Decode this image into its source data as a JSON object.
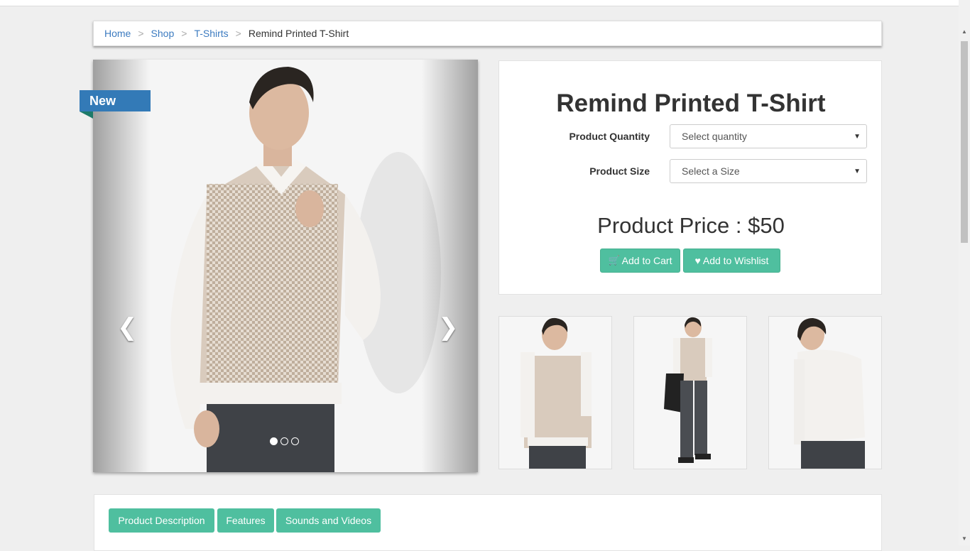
{
  "breadcrumb": {
    "items": [
      "Home",
      "Shop",
      "T-Shirts"
    ],
    "separator": ">",
    "current": "Remind Printed T-Shirt"
  },
  "carousel": {
    "badge": "New",
    "prev_icon": "chevron-left-icon",
    "next_icon": "chevron-right-icon",
    "slide_count": 3,
    "active_slide": 1
  },
  "product": {
    "title": "Remind Printed T-Shirt",
    "quantity_label": "Product Quantity",
    "quantity_value": "Select quantity",
    "size_label": "Product Size",
    "size_value": "Select a Size",
    "price": "Product Price : $50",
    "add_to_cart": "Add to Cart",
    "add_to_wishlist": "Add to Wishlist"
  },
  "tabs": [
    "Product Description",
    "Features",
    "Sounds and Videos"
  ],
  "colors": {
    "accent": "#4fbf9f",
    "link": "#3c7bc0",
    "badge": "#337ab7"
  }
}
